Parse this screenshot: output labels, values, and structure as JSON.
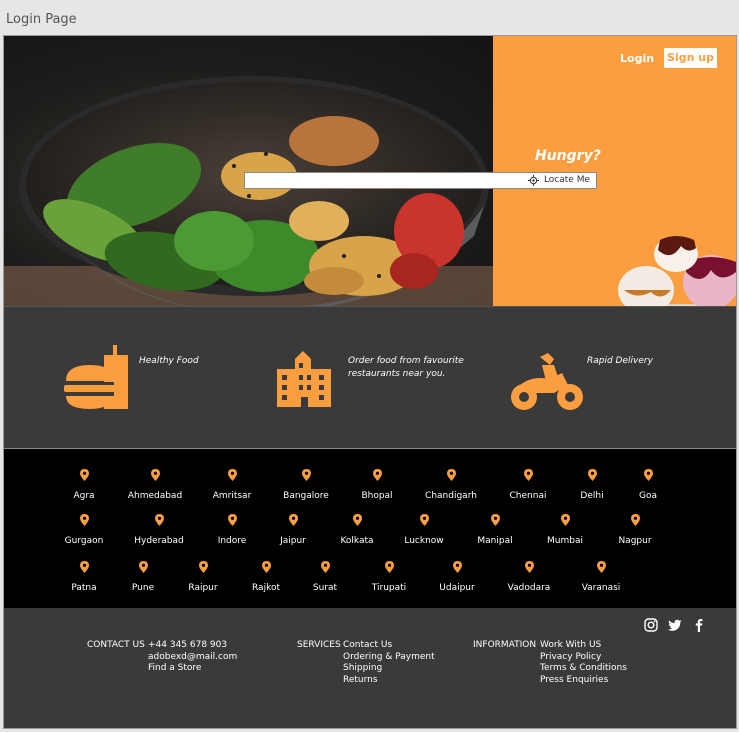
{
  "window": {
    "title": "Login Page"
  },
  "nav": {
    "login_label": "Login",
    "signup_label": "Sign up"
  },
  "hero": {
    "tagline": "Hungry?",
    "search_placeholder": "",
    "locate_label": "Locate Me"
  },
  "features": [
    {
      "icon": "burger-drink-icon",
      "text": "Healthy Food"
    },
    {
      "icon": "building-icon",
      "text": "Order food from favourite restaurants near you."
    },
    {
      "icon": "delivery-scooter-icon",
      "text": "Rapid Delivery"
    }
  ],
  "cities": [
    [
      "Agra",
      "Ahmedabad",
      "Amritsar",
      "Bangalore",
      "Bhopal",
      "Chandigarh",
      "Chennai",
      "Delhi",
      "Goa"
    ],
    [
      "Gurgaon",
      "Hyderabad",
      "Indore",
      "Jaipur",
      "Kolkata",
      "Lucknow",
      "Manipal",
      "Mumbai",
      "Nagpur"
    ],
    [
      "Patna",
      "Pune",
      "Raipur",
      "Rajkot",
      "Surat",
      "Tirupati",
      "Udaipur",
      "Vadodara",
      "Varanasi"
    ]
  ],
  "footer": {
    "contact": {
      "heading": "CONTACT US",
      "items": [
        "+44 345 678 903",
        "adobexd@mail.com",
        "Find a Store"
      ]
    },
    "services": {
      "heading": "SERVICES",
      "items": [
        "Contact Us",
        "Ordering & Payment",
        "Shipping",
        "Returns"
      ]
    },
    "information": {
      "heading": "INFORMATION",
      "items": [
        "Work With US",
        "Privacy Policy",
        "Terms & Conditions",
        "Press Enquiries"
      ]
    },
    "social": [
      "instagram-icon",
      "twitter-icon",
      "facebook-icon"
    ]
  },
  "colors": {
    "accent": "#fb9e3f",
    "dark": "#3a3a3a",
    "black": "#000000"
  }
}
